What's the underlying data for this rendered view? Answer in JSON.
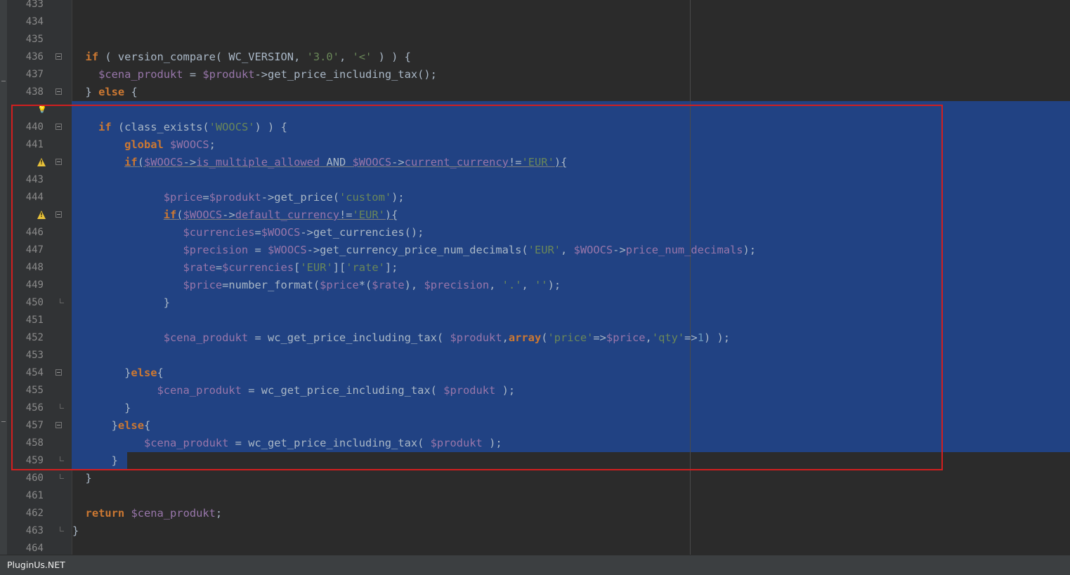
{
  "footer": {
    "brand": "PluginUs.NET"
  },
  "editor": {
    "line_numbers": [
      "433",
      "434",
      "435",
      "436",
      "437",
      "438",
      "",
      "440",
      "441",
      "",
      "443",
      "444",
      "",
      "446",
      "447",
      "448",
      "449",
      "450",
      "451",
      "452",
      "453",
      "454",
      "455",
      "456",
      "457",
      "458",
      "459",
      "460",
      "461",
      "462",
      "463",
      "464"
    ],
    "gutter_markers": {
      "lightbulb_line": "439",
      "warning_lines": [
        "442",
        "445"
      ]
    },
    "code": {
      "l436": [
        "if",
        " ( version_compare( WC_VERSION, ",
        "'3.0'",
        ", ",
        "'<'",
        " ) ) {"
      ],
      "l437": [
        "$cena_produkt",
        " = ",
        "$produkt",
        "->get_price_including_tax();"
      ],
      "l438": [
        "} ",
        "else",
        " {"
      ],
      "l440": [
        "if",
        " (class_exists(",
        "'WOOCS'",
        ") ) {"
      ],
      "l441": [
        "global",
        " ",
        "$WOOCS",
        ";"
      ],
      "l442": [
        "if",
        "(",
        "$WOOCS",
        "->",
        "is_multiple_allowed",
        " AND ",
        "$WOOCS",
        "->",
        "current_currency",
        "!=",
        "'EUR'",
        "){"
      ],
      "l444": [
        "$price",
        "=",
        "$produkt",
        "->get_price(",
        "'custom'",
        ");"
      ],
      "l445": [
        "if",
        "(",
        "$WOOCS",
        "->",
        "default_currency",
        "!=",
        "'EUR'",
        "){"
      ],
      "l446": [
        "$currencies",
        "=",
        "$WOOCS",
        "->get_currencies();"
      ],
      "l447": [
        "$precision",
        " = ",
        "$WOOCS",
        "->get_currency_price_num_decimals(",
        "'EUR'",
        ", ",
        "$WOOCS",
        "->",
        "price_num_decimals",
        ");"
      ],
      "l448": [
        "$rate",
        "=",
        "$currencies",
        "[",
        "'EUR'",
        "][",
        "'rate'",
        "];"
      ],
      "l449": [
        "$price",
        "=number_format(",
        "$price",
        "*(",
        "$rate",
        "), ",
        "$precision",
        ", ",
        "'.'",
        ", ",
        "''",
        ");"
      ],
      "l450": [
        "}"
      ],
      "l452": [
        "$cena_produkt",
        " = wc_get_price_including_tax( ",
        "$produkt",
        ",",
        "array",
        "(",
        "'price'",
        "=>",
        "$price",
        ",",
        "'qty'",
        "=>",
        "1",
        ") );"
      ],
      "l454": [
        "}",
        "else",
        "{"
      ],
      "l455": [
        "$cena_produkt",
        " = wc_get_price_including_tax( ",
        "$produkt",
        " );"
      ],
      "l456": [
        "}"
      ],
      "l457": [
        "}",
        "else",
        "{"
      ],
      "l458": [
        "$cena_produkt",
        " = wc_get_price_including_tax( ",
        "$produkt",
        " );"
      ],
      "l459": [
        "}"
      ],
      "l460": [
        "}"
      ],
      "l462": [
        "return",
        " ",
        "$cena_produkt",
        ";"
      ],
      "l463": [
        "}"
      ]
    }
  },
  "colors": {
    "background": "#2b2b2b",
    "selection": "#214283",
    "keyword": "#cc7832",
    "variable": "#9876aa",
    "string": "#6a8759",
    "number": "#6897bb",
    "highlight_box": "#d21f1f"
  }
}
